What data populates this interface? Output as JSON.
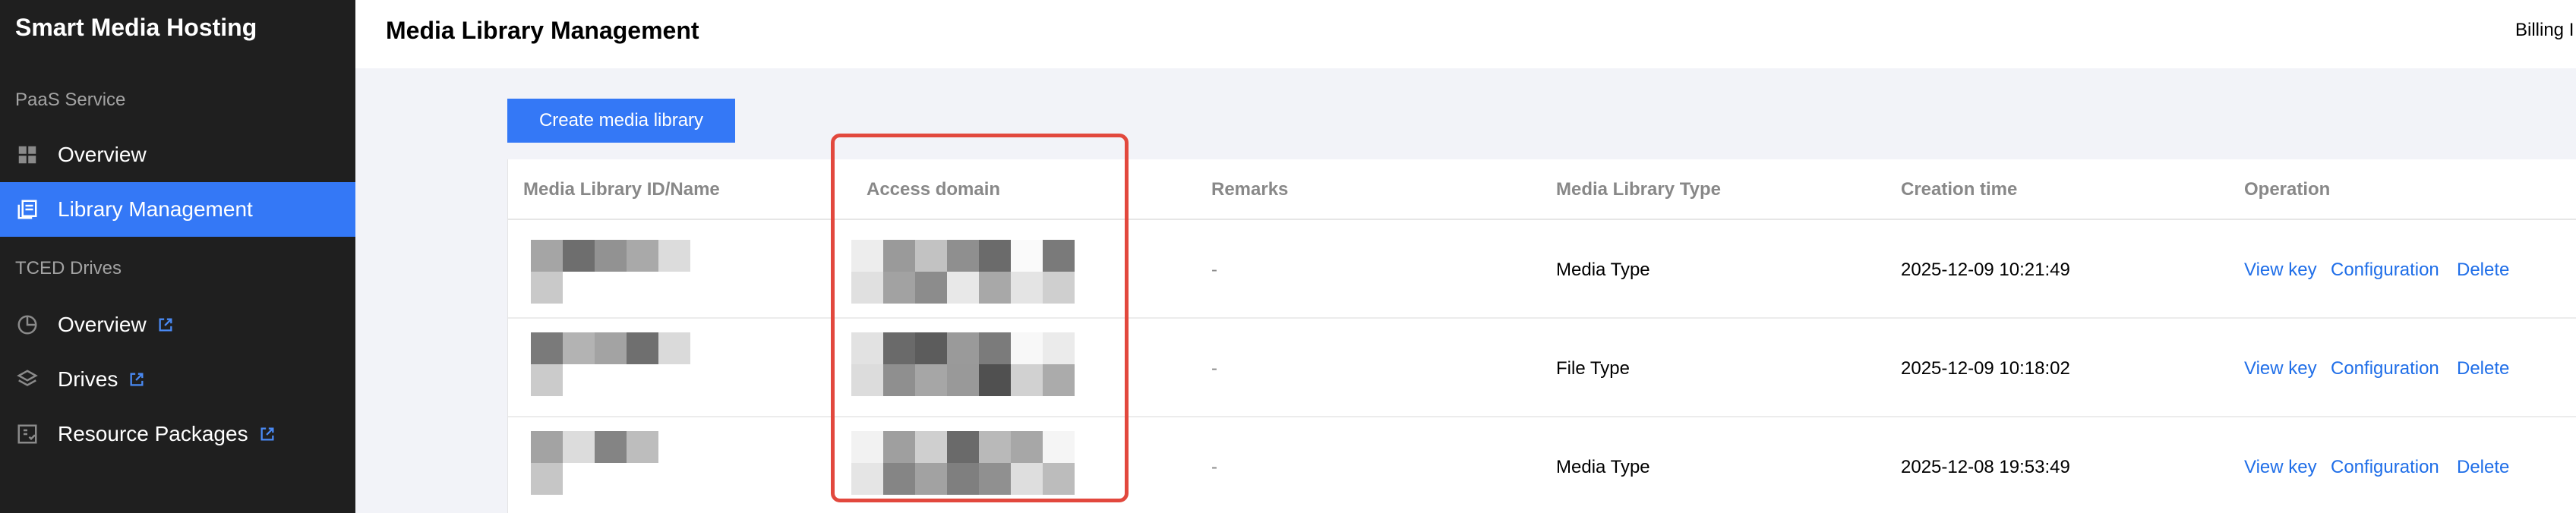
{
  "sidebar": {
    "brand": "Smart Media Hosting",
    "sections": [
      {
        "label": "PaaS Service"
      },
      {
        "label": "TCED Drives"
      }
    ],
    "items": [
      {
        "label": "Overview",
        "icon": "grid-icon",
        "active": false,
        "external": false
      },
      {
        "label": "Library Management",
        "icon": "library-icon",
        "active": true,
        "external": false
      },
      {
        "label": "Overview",
        "icon": "pie-chart-icon",
        "active": false,
        "external": true
      },
      {
        "label": "Drives",
        "icon": "layers-icon",
        "active": false,
        "external": true
      },
      {
        "label": "Resource Packages",
        "icon": "package-icon",
        "active": false,
        "external": true
      }
    ]
  },
  "header": {
    "title": "Media Library Management",
    "billing": "Billing I"
  },
  "toolbar": {
    "create_label": "Create media library"
  },
  "table": {
    "columns": [
      "Media Library ID/Name",
      "Access domain",
      "Remarks",
      "Media Library Type",
      "Creation time",
      "Operation"
    ],
    "rows": [
      {
        "remarks": "-",
        "type": "Media Type",
        "created": "2025-12-09 10:21:49",
        "ops": [
          "View key",
          "Configuration",
          "Delete"
        ]
      },
      {
        "remarks": "-",
        "type": "File Type",
        "created": "2025-12-09 10:18:02",
        "ops": [
          "View key",
          "Configuration",
          "Delete"
        ]
      },
      {
        "remarks": "-",
        "type": "Media Type",
        "created": "2025-12-08 19:53:49",
        "ops": [
          "View key",
          "Configuration",
          "Delete"
        ]
      }
    ]
  },
  "colors": {
    "sidebar_bg": "#1f1f1f",
    "accent": "#3478f6",
    "link": "#1f6ee8",
    "highlight": "#e2483d"
  }
}
